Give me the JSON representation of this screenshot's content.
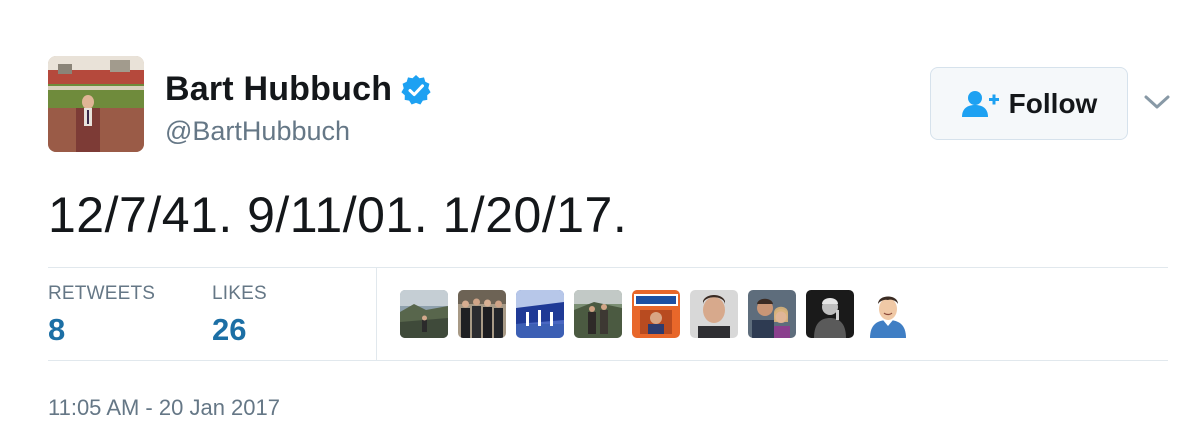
{
  "user": {
    "display_name": "Bart Hubbuch",
    "handle": "@BartHubbuch",
    "verified": true,
    "avatar_icon": "profile-photo-stadium"
  },
  "follow_button": {
    "label": "Follow",
    "icon": "add-user-icon"
  },
  "menu": {
    "icon": "chevron-down-icon"
  },
  "tweet": {
    "text": "12/7/41. 9/11/01. 1/20/17.",
    "timestamp": "11:05 AM - 20 Jan 2017"
  },
  "stats": {
    "retweets_label": "RETWEETS",
    "retweets_count": "8",
    "likes_label": "LIKES",
    "likes_count": "26"
  },
  "likers": [
    {
      "icon": "liker-avatar-cliffs"
    },
    {
      "icon": "liker-avatar-group"
    },
    {
      "icon": "liker-avatar-stadium"
    },
    {
      "icon": "liker-avatar-hikers"
    },
    {
      "icon": "liker-avatar-wheaties"
    },
    {
      "icon": "liker-avatar-man"
    },
    {
      "icon": "liker-avatar-family"
    },
    {
      "icon": "liker-avatar-bw-portrait"
    },
    {
      "icon": "liker-avatar-cartoon"
    }
  ],
  "colors": {
    "text_primary": "#14171a",
    "text_secondary": "#657786",
    "count_blue": "#1c6fa5",
    "verified_blue": "#1da1f2",
    "follow_icon_blue": "#1da1f2",
    "divider": "#e1e8ed"
  }
}
